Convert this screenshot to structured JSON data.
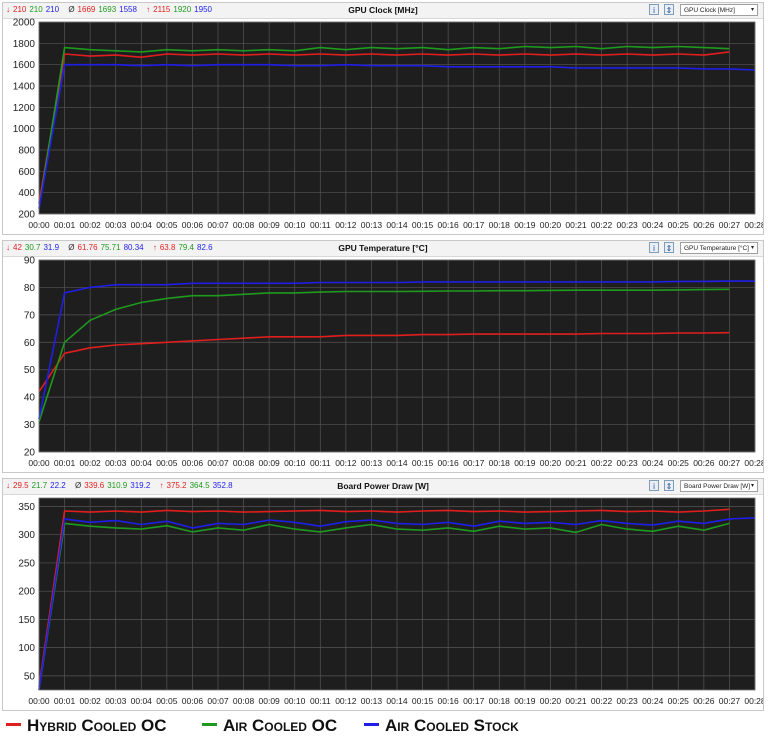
{
  "colors": {
    "hybrid": "#e01e1e",
    "air_oc": "#1e9a1e",
    "air_stock": "#1e1ee8",
    "min_arrow": "#e01e1e",
    "max_arrow": "#e01e1e",
    "avg_symbol": "#333333"
  },
  "x_ticks": [
    "00:00",
    "00:01",
    "00:02",
    "00:03",
    "00:04",
    "00:05",
    "00:06",
    "00:07",
    "00:08",
    "00:09",
    "00:10",
    "00:11",
    "00:12",
    "00:13",
    "00:14",
    "00:15",
    "00:16",
    "00:17",
    "00:18",
    "00:19",
    "00:20",
    "00:21",
    "00:22",
    "00:23",
    "00:24",
    "00:25",
    "00:26",
    "00:27",
    "00:28"
  ],
  "panels": [
    {
      "title": "GPU Clock [MHz]",
      "dropdown": "GPU Clock [MHz]",
      "btn1": "i",
      "btn2": "⇕",
      "min_symbol": "↓",
      "min_values": [
        "210",
        "210",
        "210"
      ],
      "avg_symbol": "Ø",
      "avg_values": [
        "1669",
        "1693",
        "1558"
      ],
      "max_symbol": "↑",
      "max_values": [
        "2115",
        "1920",
        "1950"
      ]
    },
    {
      "title": "GPU Temperature [°C]",
      "dropdown": "GPU Temperature [°C]",
      "btn1": "i",
      "btn2": "⇕",
      "min_symbol": "↓",
      "min_values": [
        "42",
        "30.7",
        "31.9"
      ],
      "avg_symbol": "Ø",
      "avg_values": [
        "61.76",
        "75.71",
        "80.34"
      ],
      "max_symbol": "↑",
      "max_values": [
        "63.8",
        "79.4",
        "82.6"
      ]
    },
    {
      "title": "Board Power Draw [W]",
      "dropdown": "Board Power Draw [W]",
      "btn1": "i",
      "btn2": "⇕",
      "min_symbol": "↓",
      "min_values": [
        "29.5",
        "21.7",
        "22.2"
      ],
      "avg_symbol": "Ø",
      "avg_values": [
        "339.6",
        "310.9",
        "319.2"
      ],
      "max_symbol": "↑",
      "max_values": [
        "375.2",
        "364.5",
        "352.8"
      ]
    }
  ],
  "legend": {
    "hybrid": "Hybrid Cooled OC",
    "air_oc": "Air Cooled OC",
    "air_stock": "Air Cooled Stock"
  },
  "chart_data": [
    {
      "type": "line",
      "title": "GPU Clock [MHz]",
      "xlabel": "",
      "ylabel": "",
      "ylim": [
        200,
        2000
      ],
      "y_ticks": [
        200,
        400,
        600,
        800,
        1000,
        1200,
        1400,
        1600,
        1800,
        2000
      ],
      "grid": true,
      "x": [
        "00:00",
        "00:01",
        "00:02",
        "00:03",
        "00:04",
        "00:05",
        "00:06",
        "00:07",
        "00:08",
        "00:09",
        "00:10",
        "00:11",
        "00:12",
        "00:13",
        "00:14",
        "00:15",
        "00:16",
        "00:17",
        "00:18",
        "00:19",
        "00:20",
        "00:21",
        "00:22",
        "00:23",
        "00:24",
        "00:25",
        "00:26",
        "00:27",
        "00:28"
      ],
      "series": [
        {
          "name": "Hybrid Cooled OC",
          "values": [
            300,
            1700,
            1680,
            1690,
            1670,
            1700,
            1690,
            1700,
            1690,
            1700,
            1690,
            1700,
            1690,
            1700,
            1690,
            1700,
            1690,
            1700,
            1690,
            1700,
            1690,
            1700,
            1690,
            1700,
            1690,
            1700,
            1690,
            1720,
            null
          ]
        },
        {
          "name": "Air Cooled OC",
          "values": [
            250,
            1760,
            1740,
            1730,
            1720,
            1740,
            1730,
            1740,
            1730,
            1740,
            1730,
            1760,
            1740,
            1760,
            1750,
            1760,
            1740,
            1760,
            1750,
            1770,
            1760,
            1770,
            1750,
            1770,
            1760,
            1770,
            1760,
            1750,
            null
          ]
        },
        {
          "name": "Air Cooled Stock",
          "values": [
            250,
            1600,
            1600,
            1600,
            1590,
            1600,
            1590,
            1600,
            1600,
            1600,
            1590,
            1590,
            1600,
            1590,
            1590,
            1590,
            1580,
            1580,
            1580,
            1580,
            1580,
            1570,
            1570,
            1570,
            1570,
            1570,
            1560,
            1560,
            1550
          ]
        }
      ]
    },
    {
      "type": "line",
      "title": "GPU Temperature [°C]",
      "xlabel": "",
      "ylabel": "",
      "ylim": [
        20,
        90
      ],
      "y_ticks": [
        20,
        30,
        40,
        50,
        60,
        70,
        80,
        90
      ],
      "grid": true,
      "x": [
        "00:00",
        "00:01",
        "00:02",
        "00:03",
        "00:04",
        "00:05",
        "00:06",
        "00:07",
        "00:08",
        "00:09",
        "00:10",
        "00:11",
        "00:12",
        "00:13",
        "00:14",
        "00:15",
        "00:16",
        "00:17",
        "00:18",
        "00:19",
        "00:20",
        "00:21",
        "00:22",
        "00:23",
        "00:24",
        "00:25",
        "00:26",
        "00:27",
        "00:28"
      ],
      "series": [
        {
          "name": "Hybrid Cooled OC",
          "values": [
            42,
            56,
            58,
            59,
            59.5,
            60,
            60.5,
            61,
            61.5,
            62,
            62,
            62,
            62.5,
            62.5,
            62.5,
            62.8,
            62.8,
            63,
            63,
            63,
            63,
            63,
            63.2,
            63.2,
            63.2,
            63.4,
            63.4,
            63.5,
            null
          ]
        },
        {
          "name": "Air Cooled OC",
          "values": [
            31,
            60,
            68,
            72,
            74.5,
            76,
            77,
            77,
            77.5,
            78,
            78,
            78.3,
            78.5,
            78.5,
            78.5,
            78.6,
            78.7,
            78.7,
            78.8,
            78.8,
            78.9,
            79,
            79,
            79,
            79,
            79.1,
            79.2,
            79.3,
            null
          ]
        },
        {
          "name": "Air Cooled Stock",
          "values": [
            32,
            78,
            80,
            81,
            81,
            81,
            81.5,
            81.5,
            81.5,
            81.5,
            81.5,
            81.8,
            81.8,
            81.8,
            81.8,
            82,
            82,
            82,
            82,
            82,
            82,
            82,
            82,
            82,
            82,
            82.2,
            82.2,
            82.3,
            82.3
          ]
        }
      ]
    },
    {
      "type": "line",
      "title": "Board Power Draw [W]",
      "xlabel": "",
      "ylabel": "",
      "ylim": [
        25,
        365
      ],
      "y_ticks": [
        50,
        100,
        150,
        200,
        250,
        300,
        350
      ],
      "grid": true,
      "x": [
        "00:00",
        "00:01",
        "00:02",
        "00:03",
        "00:04",
        "00:05",
        "00:06",
        "00:07",
        "00:08",
        "00:09",
        "00:10",
        "00:11",
        "00:12",
        "00:13",
        "00:14",
        "00:15",
        "00:16",
        "00:17",
        "00:18",
        "00:19",
        "00:20",
        "00:21",
        "00:22",
        "00:23",
        "00:24",
        "00:25",
        "00:26",
        "00:27",
        "00:28"
      ],
      "series": [
        {
          "name": "Hybrid Cooled OC",
          "values": [
            30,
            342,
            340,
            342,
            340,
            343,
            341,
            342,
            340,
            341,
            342,
            343,
            341,
            342,
            340,
            342,
            343,
            341,
            342,
            340,
            341,
            342,
            343,
            341,
            342,
            340,
            342,
            345,
            null
          ]
        },
        {
          "name": "Air Cooled OC",
          "values": [
            25,
            320,
            315,
            312,
            310,
            316,
            305,
            312,
            308,
            318,
            310,
            305,
            312,
            318,
            310,
            308,
            312,
            306,
            315,
            310,
            312,
            304,
            318,
            310,
            306,
            315,
            308,
            320,
            null
          ]
        },
        {
          "name": "Air Cooled Stock",
          "values": [
            25,
            328,
            322,
            325,
            318,
            324,
            312,
            320,
            318,
            326,
            322,
            315,
            323,
            326,
            320,
            318,
            322,
            315,
            324,
            320,
            322,
            318,
            325,
            320,
            317,
            324,
            320,
            328,
            330
          ]
        }
      ]
    }
  ]
}
